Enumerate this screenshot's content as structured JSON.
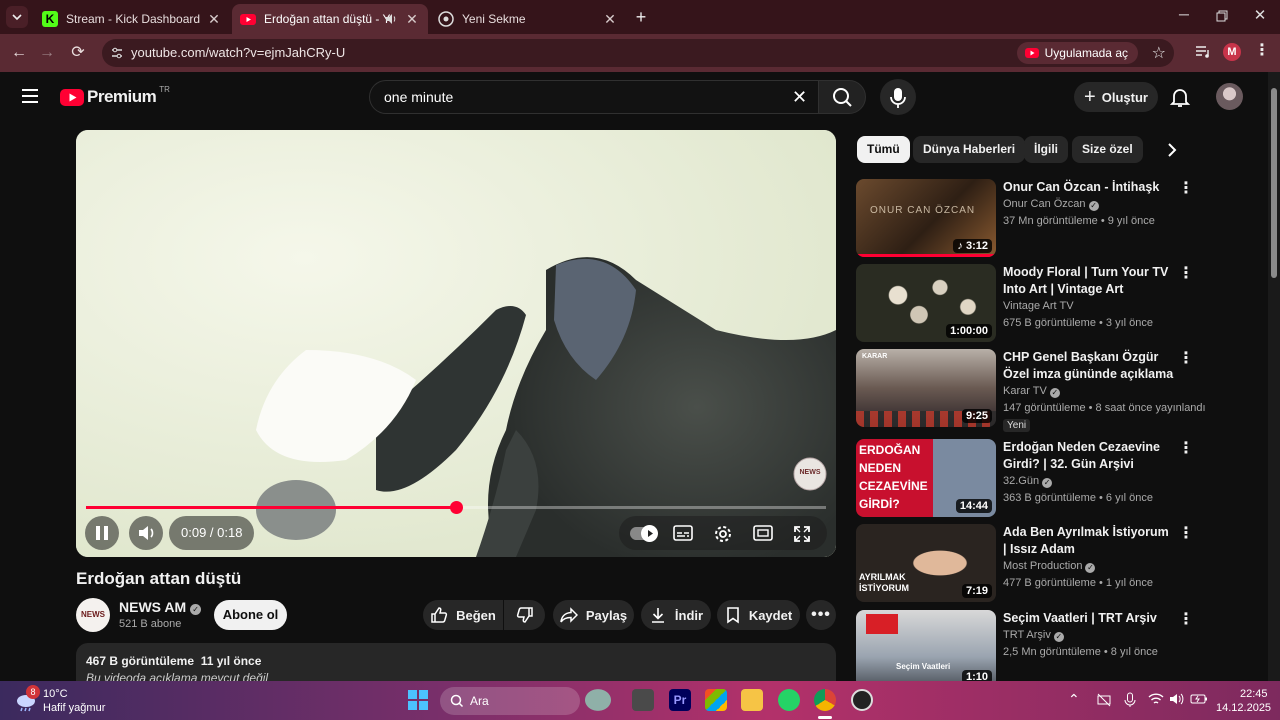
{
  "browser": {
    "tabs": [
      {
        "title": "Stream - Kick Dashboard",
        "active": false
      },
      {
        "title": "Erdoğan attan düştü - YouT",
        "active": true
      },
      {
        "title": "Yeni Sekme",
        "active": false
      }
    ],
    "url": "youtube.com/watch?v=ejmJahCRy-U",
    "open_in_app": "Uygulamada aç",
    "profile_initial": "M",
    "accent": "#5a2a33"
  },
  "header": {
    "logo": "Premium",
    "region": "TR",
    "search_query": "one minute",
    "create_label": "Oluştur"
  },
  "player": {
    "time": "0:09 / 0:18",
    "progress_fraction": 0.5,
    "watermark": "NEWS"
  },
  "video": {
    "title": "Erdoğan attan düştü",
    "channel": "NEWS AM",
    "avatar_text": "NEWS",
    "subscribers": "521 B abone",
    "subscribe_label": "Abone ol",
    "like_label": "Beğen",
    "share_label": "Paylaş",
    "download_label": "İndir",
    "save_label": "Kaydet",
    "views_date": "467 B görüntüleme  11 yıl önce",
    "description": "Bu videoda açıklama mevcut değil"
  },
  "chips": [
    "Tümü",
    "Dünya Haberleri",
    "İlgili",
    "Size özel"
  ],
  "recommendations": [
    {
      "title": "Onur Can Özcan - İntihaşk",
      "channel": "Onur Can Özcan",
      "meta": "37 Mn görüntüleme • 9 yıl önce",
      "duration": "3:12",
      "thumb_text": "ONUR CAN ÖZCAN"
    },
    {
      "title": "Moody Floral | Turn Your TV Into Art | Vintage Art Slideshow Fo...",
      "channel": "Vintage Art TV",
      "meta": "675 B görüntüleme • 3 yıl önce",
      "duration": "1:00:00",
      "thumb_text": ""
    },
    {
      "title": "CHP Genel Başkanı Özgür Özel imza gününde açıklama yapıyor",
      "channel": "Karar TV",
      "meta": "147 görüntüleme • 8 saat önce yayınlandı",
      "duration": "9:25",
      "badge": "Yeni",
      "thumb_text": "KARAR"
    },
    {
      "title": "Erdoğan Neden Cezaevine Girdi? | 32. Gün Arşivi",
      "channel": "32.Gün",
      "meta": "363 B görüntüleme • 6 yıl önce",
      "duration": "14:44",
      "thumb_text": "ERDOĞAN NEDEN CEZAEVİNE GİRDİ?"
    },
    {
      "title": "Ada Ben Ayrılmak İstiyorum | Issız Adam",
      "channel": "Most Production",
      "meta": "477 B görüntüleme • 1 yıl önce",
      "duration": "7:19",
      "thumb_text": "AYRILMAK İSTİYORUM"
    },
    {
      "title": "Seçim Vaatleri | TRT Arşiv",
      "channel": "TRT Arşiv",
      "meta": "2,5 Mn görüntüleme • 8 yıl önce",
      "duration": "1:10",
      "thumb_text": "Seçim Vaatleri"
    }
  ],
  "taskbar": {
    "weather_temp": "10°C",
    "weather_desc": "Hafif yağmur",
    "weather_badge": "8",
    "search_label": "Ara",
    "time": "22:45",
    "date": "14.12.2025"
  }
}
